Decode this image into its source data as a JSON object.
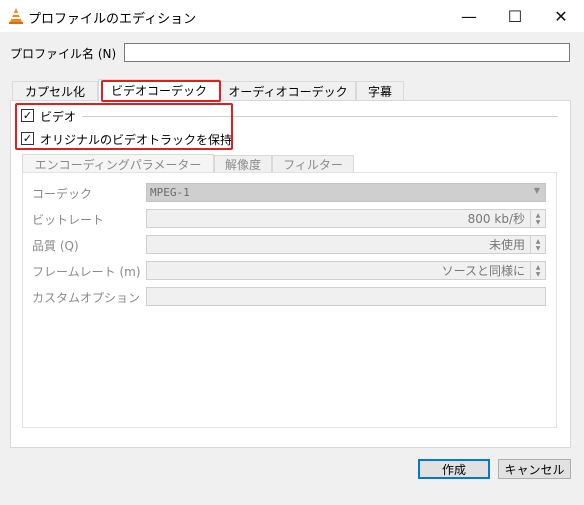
{
  "window": {
    "title": "プロファイルのエディション",
    "minimize": "—",
    "maximize": "☐",
    "close": "✕"
  },
  "profile": {
    "name_label": "プロファイル名 (N)",
    "name_value": ""
  },
  "tabs": [
    {
      "label": "カプセル化"
    },
    {
      "label": "ビデオコーデック"
    },
    {
      "label": "オーディオコーデック"
    },
    {
      "label": "字幕"
    }
  ],
  "video": {
    "checkbox_label": "ビデオ",
    "keep_track_label": "オリジナルのビデオトラックを保持",
    "checked_glyph": "✓"
  },
  "subtabs": [
    {
      "label": "エンコーディングパラメーター"
    },
    {
      "label": "解像度"
    },
    {
      "label": "フィルター"
    }
  ],
  "params": {
    "codec": {
      "label": "コーデック",
      "value": "MPEG-1"
    },
    "bitrate": {
      "label": "ビットレート",
      "value": "800 kb/秒"
    },
    "quality": {
      "label": "品質 (Q)",
      "value": "未使用"
    },
    "framerate": {
      "label": "フレームレート (m)",
      "value": "ソースと同様に"
    },
    "custom": {
      "label": "カスタムオプション",
      "value": ""
    }
  },
  "buttons": {
    "create": "作成",
    "cancel": "キャンセル"
  },
  "colors": {
    "highlight": "#e02020",
    "focus": "#0078d7",
    "vlc_cone": "#f08a1c"
  }
}
